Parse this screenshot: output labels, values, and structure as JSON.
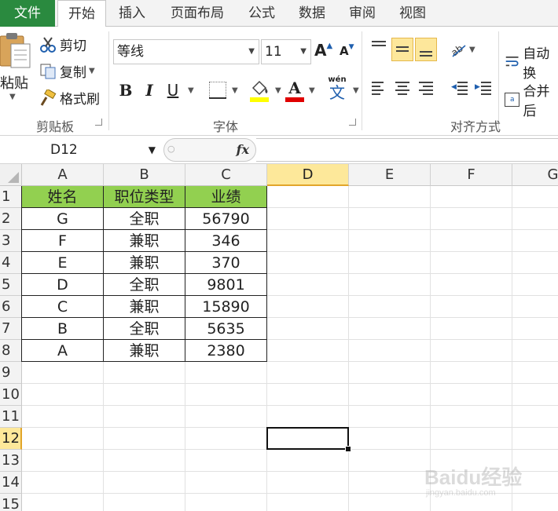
{
  "tabs": [
    {
      "label": "文件",
      "name": "tab-file"
    },
    {
      "label": "开始",
      "name": "tab-home"
    },
    {
      "label": "插入",
      "name": "tab-insert"
    },
    {
      "label": "页面布局",
      "name": "tab-page-layout"
    },
    {
      "label": "公式",
      "name": "tab-formulas"
    },
    {
      "label": "数据",
      "name": "tab-data"
    },
    {
      "label": "审阅",
      "name": "tab-review"
    },
    {
      "label": "视图",
      "name": "tab-view"
    }
  ],
  "ribbon": {
    "clipboard": {
      "paste_label": "粘贴",
      "cut_label": "剪切",
      "copy_label": "复制",
      "format_painter_label": "格式刷",
      "group_label": "剪贴板"
    },
    "font": {
      "font_name": "等线",
      "font_size": "11",
      "bold": "B",
      "italic": "I",
      "underline": "U",
      "font_color_glyph": "A",
      "phonetic_glyph": "文",
      "phonetic_top": "wén",
      "grow_glyph": "A",
      "shrink_glyph": "A",
      "group_label": "字体",
      "fill_color": "#ffff00",
      "font_color": "#e00000"
    },
    "alignment": {
      "wrap_label": "自动换",
      "merge_label": "合并后",
      "group_label": "对齐方式",
      "merge_glyph": "a"
    }
  },
  "formula_bar": {
    "name_box": "D12",
    "fx": "fx",
    "formula": ""
  },
  "sheet": {
    "columns": [
      "A",
      "B",
      "C",
      "D",
      "E",
      "F",
      "G"
    ],
    "rows": [
      "1",
      "2",
      "3",
      "4",
      "5",
      "6",
      "7",
      "8",
      "9",
      "10",
      "11",
      "12",
      "13",
      "14",
      "15"
    ],
    "selected_column": "D",
    "selected_row": "12",
    "header": [
      "姓名",
      "职位类型",
      "业绩"
    ],
    "data": [
      [
        "G",
        "全职",
        "56790"
      ],
      [
        "F",
        "兼职",
        "346"
      ],
      [
        "E",
        "兼职",
        "370"
      ],
      [
        "D",
        "全职",
        "9801"
      ],
      [
        "C",
        "兼职",
        "15890"
      ],
      [
        "B",
        "全职",
        "5635"
      ],
      [
        "A",
        "兼职",
        "2380"
      ]
    ],
    "header_fill": "#92d050"
  },
  "watermark": {
    "text": "Baidu经验",
    "sub": "jingyan.baidu.com"
  }
}
